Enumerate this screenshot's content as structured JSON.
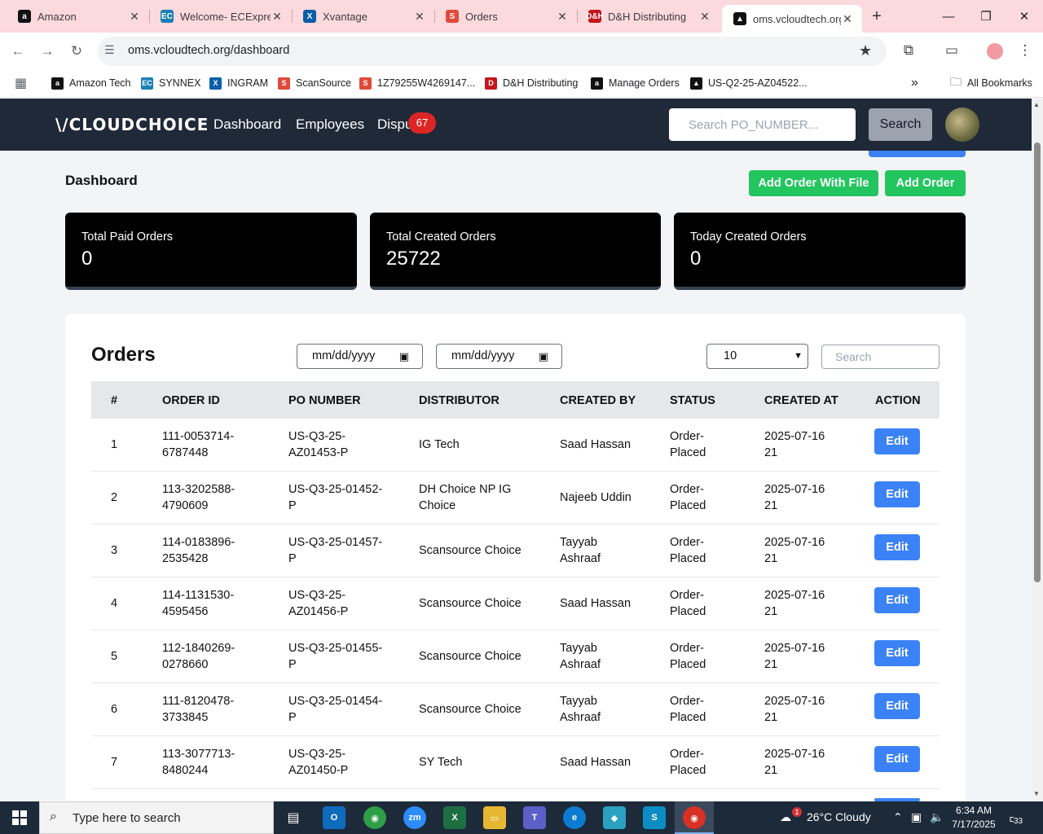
{
  "browser": {
    "tabs": [
      {
        "title": "Amazon",
        "icon": "amazon-icon",
        "color": "#111111",
        "glyph": "a"
      },
      {
        "title": "Welcome- ECExpre",
        "icon": "ecexpress-icon",
        "color": "#1a7fb5",
        "glyph": "EC"
      },
      {
        "title": "Xvantage",
        "icon": "xvantage-icon",
        "color": "#0b5ea8",
        "glyph": "X"
      },
      {
        "title": "Orders",
        "icon": "scansource-icon",
        "color": "#e04a3a",
        "glyph": "S"
      },
      {
        "title": "D&H Distributing",
        "icon": "dh-icon",
        "color": "#c4161c",
        "glyph": "D&H"
      },
      {
        "title": "oms.vcloudtech.org",
        "icon": "vcloud-icon",
        "color": "#111111",
        "glyph": "▲"
      }
    ],
    "url": "oms.vcloudtech.org/dashboard",
    "bookmarks": [
      {
        "label": "Amazon Tech",
        "color": "#111111",
        "glyph": "a"
      },
      {
        "label": "SYNNEX",
        "color": "#1a7fb5",
        "glyph": "EC"
      },
      {
        "label": "INGRAM",
        "color": "#0b5ea8",
        "glyph": "X"
      },
      {
        "label": "ScanSource",
        "color": "#e04a3a",
        "glyph": "S"
      },
      {
        "label": "1Z79255W4269147...",
        "color": "#e04a3a",
        "glyph": "S"
      },
      {
        "label": "D&H Distributing",
        "color": "#c4161c",
        "glyph": "D"
      },
      {
        "label": "Manage Orders",
        "color": "#111111",
        "glyph": "a"
      },
      {
        "label": "US-Q2-25-AZ04522...",
        "color": "#111111",
        "glyph": "▲"
      }
    ],
    "all_bookmarks": "All Bookmarks"
  },
  "header": {
    "logo": "\\/CLOUDCHOICE",
    "nav": [
      "Dashboard",
      "Employees",
      "Dispu"
    ],
    "disputes_count": "67",
    "search_placeholder": "Search PO_NUMBER...",
    "search_button": "Search"
  },
  "dashboard": {
    "title": "Dashboard",
    "add_with_file": "Add Order With File",
    "add_order": "Add Order",
    "stats": [
      {
        "label": "Total Paid Orders",
        "value": "0"
      },
      {
        "label": "Total Created Orders",
        "value": "25722"
      },
      {
        "label": "Today Created Orders",
        "value": "0"
      }
    ]
  },
  "orders": {
    "title": "Orders",
    "date_from": "mm/dd/yyyy",
    "date_to": "mm/dd/yyyy",
    "page_size": "10",
    "search_placeholder": "Search",
    "columns": [
      "#",
      "ORDER ID",
      "PO NUMBER",
      "DISTRIBUTOR",
      "CREATED BY",
      "STATUS",
      "CREATED AT",
      "ACTION"
    ],
    "rows": [
      {
        "n": "1",
        "order_id": [
          "111-0053714-",
          "6787448"
        ],
        "po": [
          "US-Q3-25-",
          "AZ01453-P"
        ],
        "dist": [
          "IG Tech"
        ],
        "by": [
          "Saad Hassan"
        ],
        "status": [
          "Order-",
          "Placed"
        ],
        "at": [
          "2025-07-16",
          "21"
        ],
        "action": "Edit"
      },
      {
        "n": "2",
        "order_id": [
          "113-3202588-",
          "4790609"
        ],
        "po": [
          "US-Q3-25-01452-",
          "P"
        ],
        "dist": [
          "DH Choice NP IG",
          "Choice"
        ],
        "by": [
          "Najeeb Uddin"
        ],
        "status": [
          "Order-",
          "Placed"
        ],
        "at": [
          "2025-07-16",
          "21"
        ],
        "action": "Edit"
      },
      {
        "n": "3",
        "order_id": [
          "114-0183896-",
          "2535428"
        ],
        "po": [
          "US-Q3-25-01457-",
          "P"
        ],
        "dist": [
          "Scansource Choice"
        ],
        "by": [
          "Tayyab",
          "Ashraaf"
        ],
        "status": [
          "Order-",
          "Placed"
        ],
        "at": [
          "2025-07-16",
          "21"
        ],
        "action": "Edit"
      },
      {
        "n": "4",
        "order_id": [
          "114-1131530-",
          "4595456"
        ],
        "po": [
          "US-Q3-25-",
          "AZ01456-P"
        ],
        "dist": [
          "Scansource Choice"
        ],
        "by": [
          "Saad Hassan"
        ],
        "status": [
          "Order-",
          "Placed"
        ],
        "at": [
          "2025-07-16",
          "21"
        ],
        "action": "Edit"
      },
      {
        "n": "5",
        "order_id": [
          "112-1840269-",
          "0278660"
        ],
        "po": [
          "US-Q3-25-01455-",
          "P"
        ],
        "dist": [
          "Scansource Choice"
        ],
        "by": [
          "Tayyab",
          "Ashraaf"
        ],
        "status": [
          "Order-",
          "Placed"
        ],
        "at": [
          "2025-07-16",
          "21"
        ],
        "action": "Edit"
      },
      {
        "n": "6",
        "order_id": [
          "111-8120478-",
          "3733845"
        ],
        "po": [
          "US-Q3-25-01454-",
          "P"
        ],
        "dist": [
          "Scansource Choice"
        ],
        "by": [
          "Tayyab",
          "Ashraaf"
        ],
        "status": [
          "Order-",
          "Placed"
        ],
        "at": [
          "2025-07-16",
          "21"
        ],
        "action": "Edit"
      },
      {
        "n": "7",
        "order_id": [
          "113-3077713-",
          "8480244"
        ],
        "po": [
          "US-Q3-25-",
          "AZ01450-P"
        ],
        "dist": [
          "SY Tech"
        ],
        "by": [
          "Saad Hassan"
        ],
        "status": [
          "Order-",
          "Placed"
        ],
        "at": [
          "2025-07-16",
          "21"
        ],
        "action": "Edit"
      }
    ]
  },
  "taskbar": {
    "search_text": "Type here to search",
    "weather": "26°C  Cloudy",
    "weather_alert": "1",
    "time": "6:34 AM",
    "date": "7/17/2025",
    "notifications": "33"
  },
  "colors": {
    "header_bg": "#1f2937",
    "accent_green": "#22c55e",
    "accent_blue": "#3b82f6",
    "badge_red": "#dc2626"
  }
}
